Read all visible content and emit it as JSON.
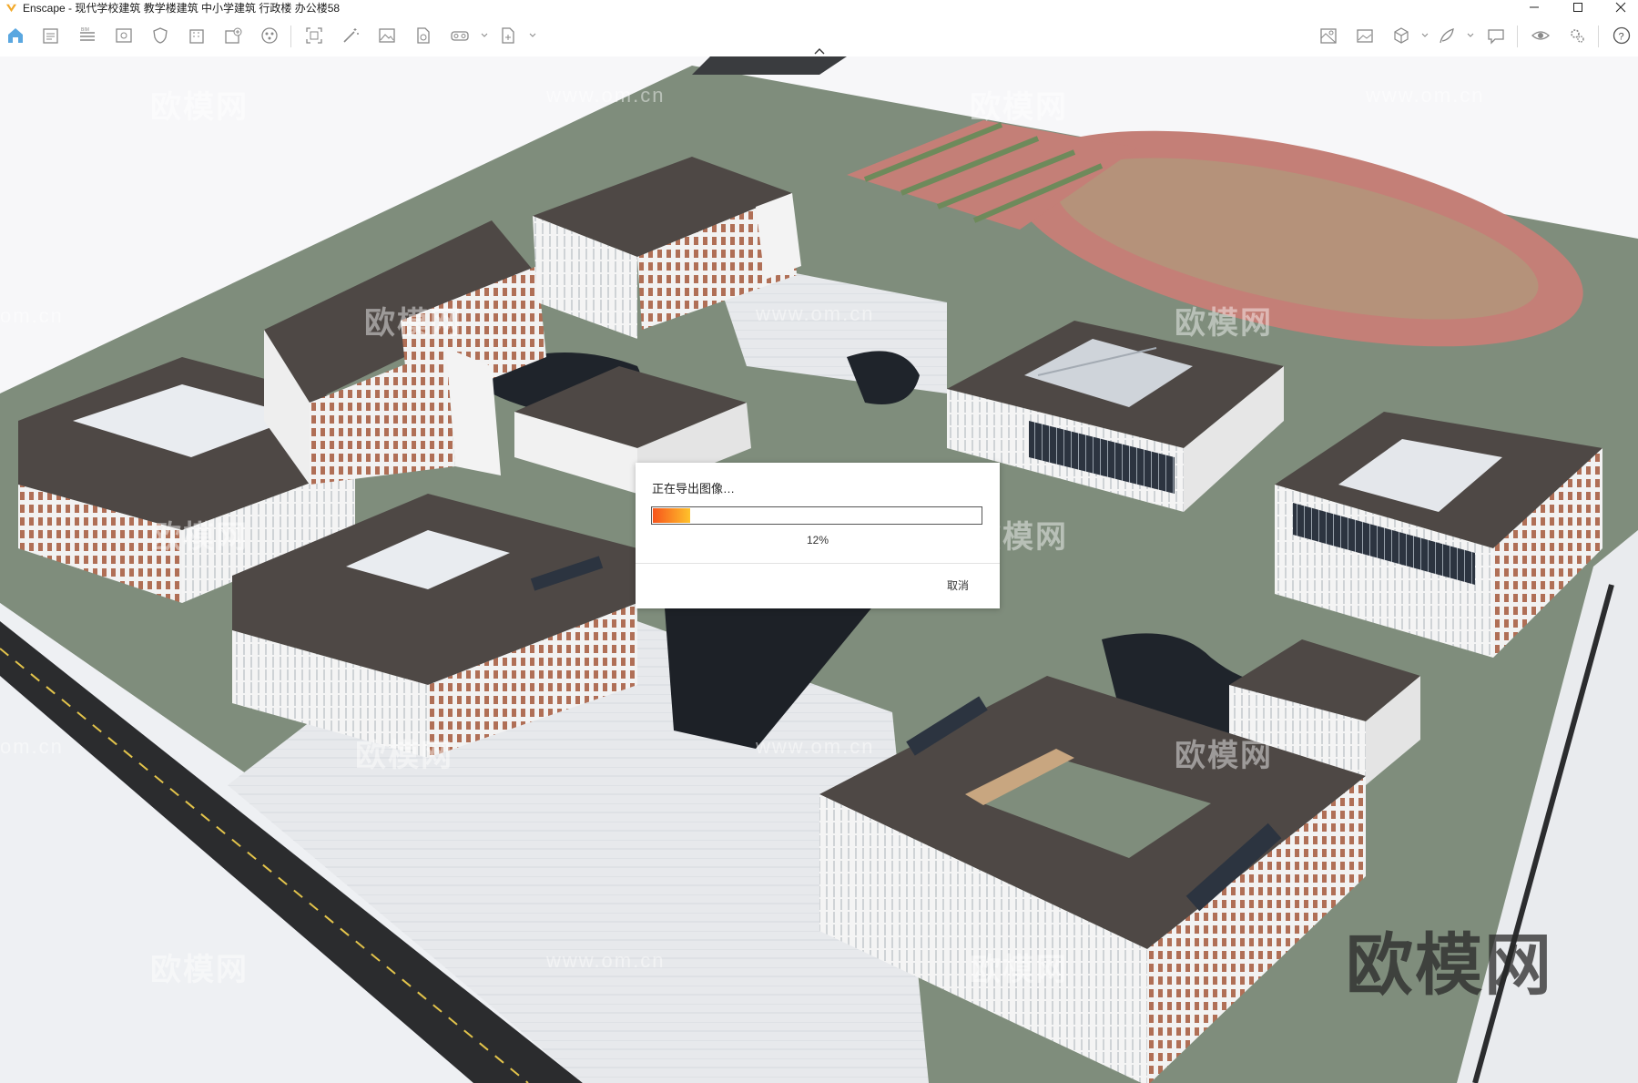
{
  "window": {
    "title": "Enscape - 现代学校建筑 教学楼建筑 中小学建筑 行政楼 办公楼58"
  },
  "toolbar": {
    "left_icons": [
      "home-icon",
      "bim-document-icon",
      "bim-list-icon",
      "view-management-icon",
      "shield-icon",
      "building-icon",
      "add-building-icon",
      "asset-library-icon",
      "screenshot-icon",
      "magic-wand-icon",
      "render-image-icon",
      "export-document-icon",
      "vr-headset-icon",
      "export-file-icon"
    ],
    "right_icons": [
      "map-icon",
      "image-gallery-icon",
      "cube-icon",
      "feather-icon",
      "chat-bubble-icon",
      "eye-icon",
      "settings-icon",
      "help-icon"
    ]
  },
  "dialog": {
    "message": "正在导出图像…",
    "progress": 0.12,
    "percent_label": "12%",
    "cancel_label": "取消"
  },
  "watermarks": {
    "logo_text": "欧模网",
    "url_text": "www.om.cn",
    "partial_url": "om.cn"
  },
  "colors": {
    "progress_start": "#f7541c",
    "progress_end": "#fec22b",
    "roof": "#4e4845",
    "ground": "#7f8d7c",
    "track": "#c47f77"
  }
}
